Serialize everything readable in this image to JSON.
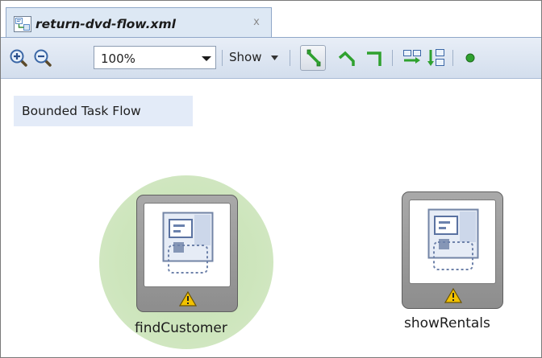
{
  "editor_tab": {
    "title": "return-dvd-flow.xml",
    "close_glyph": "x",
    "icon": "task-flow-file-icon"
  },
  "toolbar": {
    "zoom_in_icon": "zoom-in-icon",
    "zoom_out_icon": "zoom-out-icon",
    "zoom_value": "100%",
    "show_label": "Show",
    "line_style_icons": [
      "straight-line-icon",
      "angled-line-icon",
      "orthogonal-line-icon"
    ],
    "layout_icons": [
      "layout-horizontal-icon",
      "layout-vertical-icon"
    ],
    "overflow_icon": "start-node-icon"
  },
  "canvas": {
    "flow_type_label": "Bounded Task Flow",
    "nodes": [
      {
        "label": "findCustomer",
        "selected": true,
        "warning": true,
        "icon": "view-activity-icon"
      },
      {
        "label": "showRentals",
        "selected": false,
        "warning": true,
        "icon": "view-activity-icon"
      }
    ]
  },
  "colors": {
    "tab_bg": "#dde8f4",
    "toolbar_bg": "#d3deed",
    "selection_halo": "#cde5bc",
    "flow_label_bg": "#e3ebf8",
    "warning": "#f2c200",
    "line_tool_green": "#2fa12f"
  }
}
